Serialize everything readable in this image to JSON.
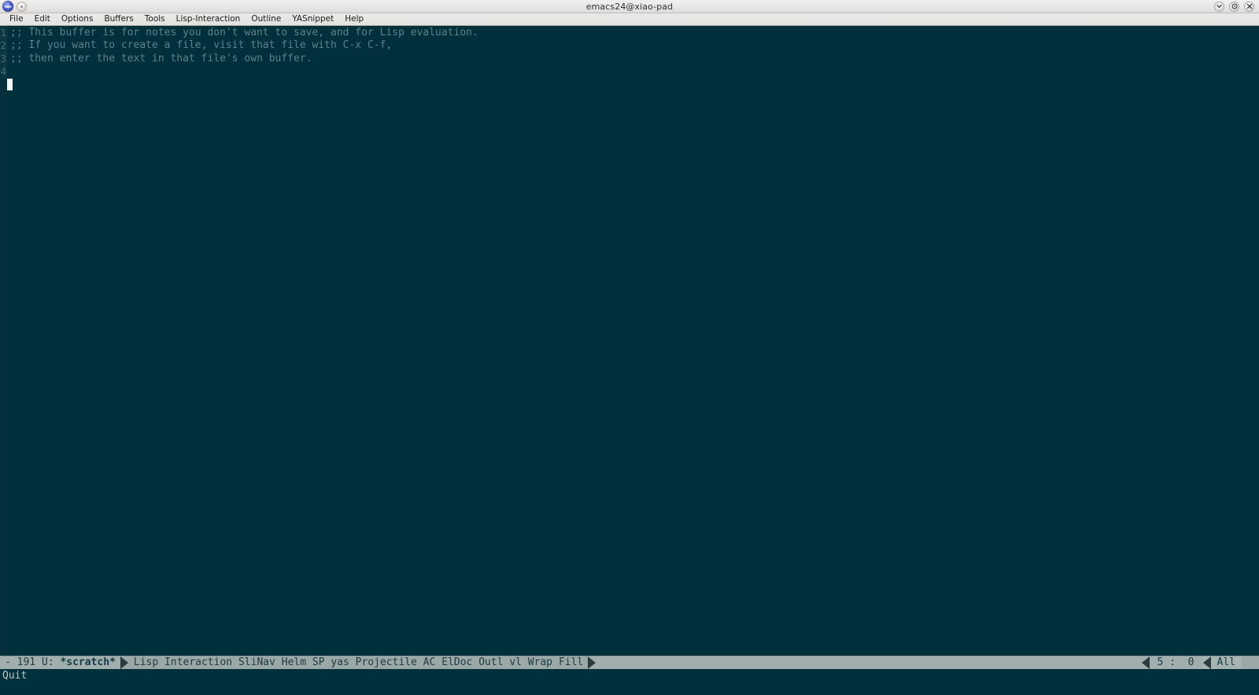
{
  "titlebar": {
    "title": "emacs24@xiao-pad",
    "app_icon": "emacs-globe-icon",
    "menu_dot_icon": "window-menu-dot-icon",
    "controls": [
      {
        "name": "minimize-button",
        "icon": "chevron-down-icon",
        "glyph": "⌄"
      },
      {
        "name": "maximize-button",
        "icon": "circle-dot-icon",
        "glyph": "●"
      },
      {
        "name": "close-button",
        "icon": "close-x-icon",
        "glyph": "✕"
      }
    ]
  },
  "menubar": {
    "items": [
      {
        "label": "File"
      },
      {
        "label": "Edit"
      },
      {
        "label": "Options"
      },
      {
        "label": "Buffers"
      },
      {
        "label": "Tools"
      },
      {
        "label": "Lisp-Interaction"
      },
      {
        "label": "Outline"
      },
      {
        "label": "YASnippet"
      },
      {
        "label": "Help"
      }
    ]
  },
  "buffer": {
    "name": "*scratch*",
    "lines": [
      {
        "number": "1",
        "text": ";; This buffer is for notes you don't want to save, and for Lisp evaluation."
      },
      {
        "number": "2",
        "text": ";; If you want to create a file, visit that file with C-x C-f,"
      },
      {
        "number": "3",
        "text": ";; then enter the text in that file's own buffer."
      },
      {
        "number": "4",
        "text": ""
      }
    ],
    "cursor": {
      "line": 5,
      "column": 0
    }
  },
  "modeline": {
    "left": "- 191 U: ",
    "buffer_name": "*scratch*",
    "major_mode": "Lisp Interaction",
    "minor_modes": "SliNav Helm SP yas Projectile AC ElDoc Outl vl Wrap Fill",
    "position": "5 :  0",
    "scroll": "All"
  },
  "echo": {
    "message": "Quit"
  },
  "colors": {
    "background": "#00303c",
    "fringe": "#05303b",
    "line_number": "#4a6a72",
    "comment_text": "#5f8087",
    "cursor": "#f4f6f6",
    "modeline_bg": "#a0aeae",
    "modeline_modes_bg": "#9aa8a8",
    "modeline_fg": "#1d3b42",
    "titlebar_bg": "#e8e7e5",
    "menubar_bg": "#e7e5e2"
  }
}
